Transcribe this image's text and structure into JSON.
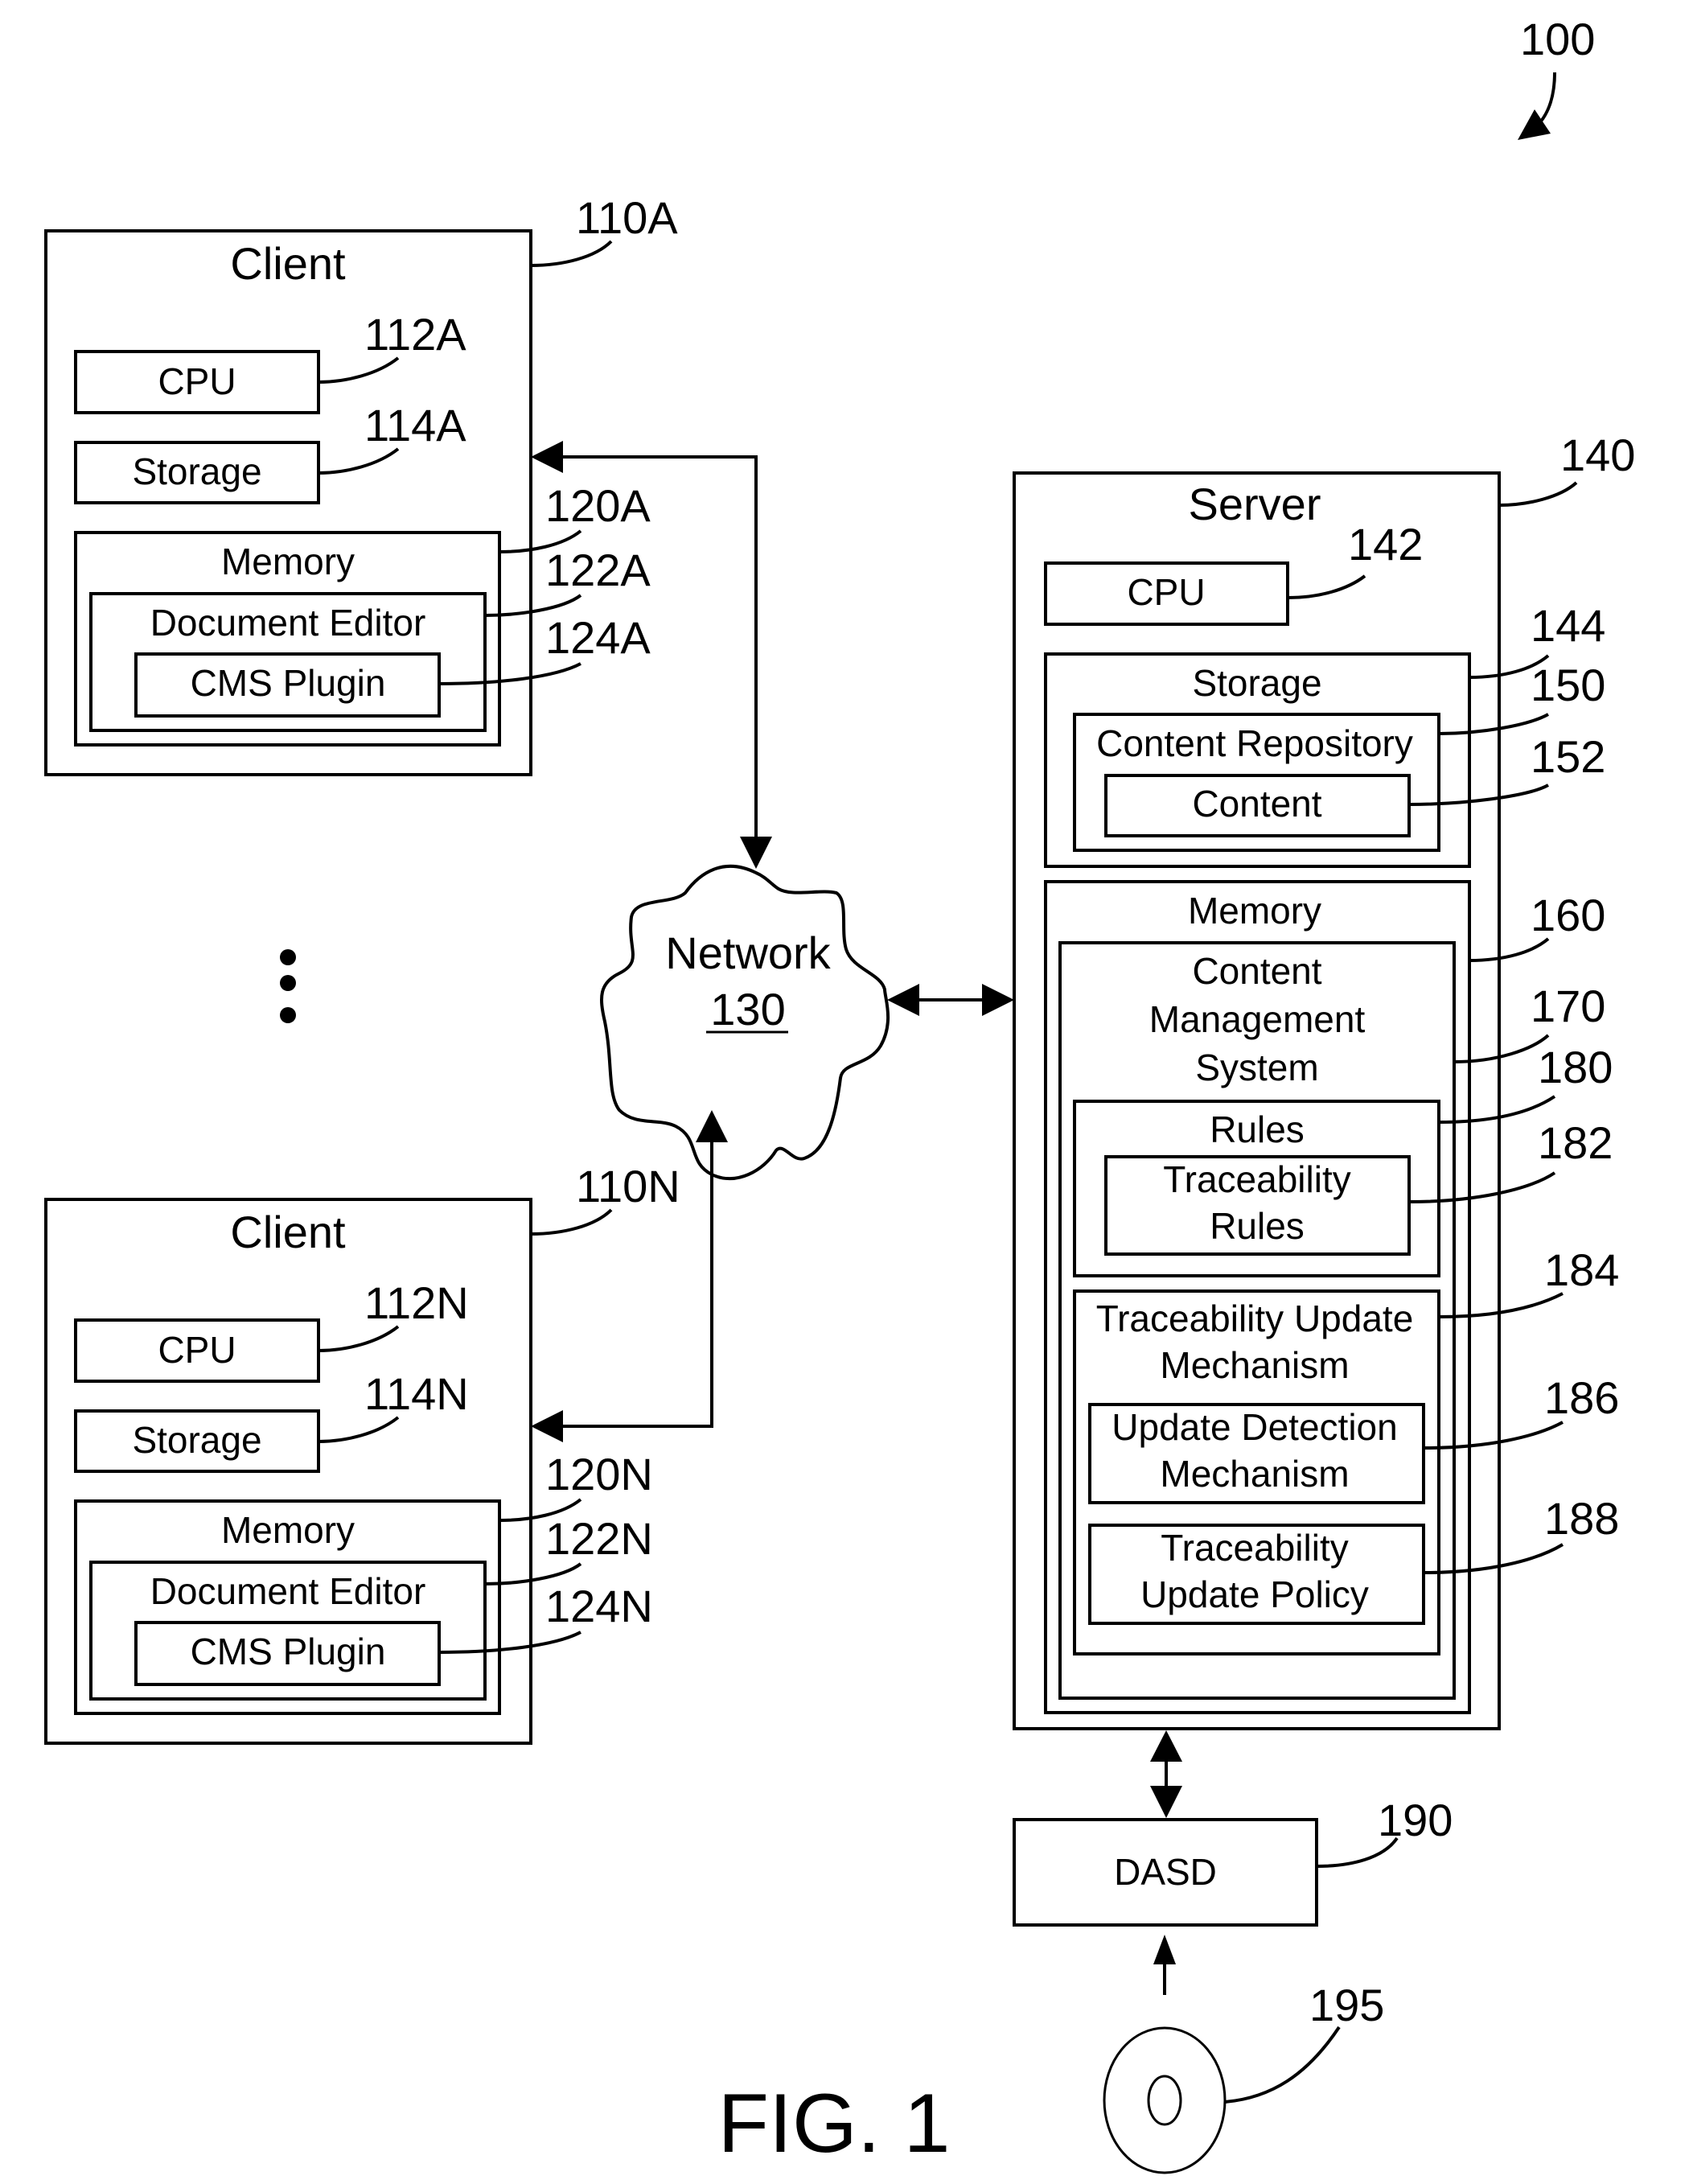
{
  "figure": {
    "caption": "FIG. 1",
    "system_ref": "100"
  },
  "client_a": {
    "title": "Client",
    "ref": "110A",
    "cpu": {
      "label": "CPU",
      "ref": "112A"
    },
    "storage": {
      "label": "Storage",
      "ref": "114A"
    },
    "memory": {
      "label": "Memory",
      "ref": "120A"
    },
    "document_editor": {
      "label": "Document Editor",
      "ref": "122A"
    },
    "cms_plugin": {
      "label": "CMS Plugin",
      "ref": "124A"
    }
  },
  "client_n": {
    "title": "Client",
    "ref": "110N",
    "cpu": {
      "label": "CPU",
      "ref": "112N"
    },
    "storage": {
      "label": "Storage",
      "ref": "114N"
    },
    "memory": {
      "label": "Memory",
      "ref": "120N"
    },
    "document_editor": {
      "label": "Document Editor",
      "ref": "122N"
    },
    "cms_plugin": {
      "label": "CMS Plugin",
      "ref": "124N"
    }
  },
  "network": {
    "label": "Network",
    "ref": "130"
  },
  "server": {
    "title": "Server",
    "ref": "140",
    "cpu": {
      "label": "CPU",
      "ref": "142"
    },
    "storage": {
      "label": "Storage",
      "ref": "144"
    },
    "content_repository": {
      "label": "Content Repository",
      "ref": "150"
    },
    "content": {
      "label": "Content",
      "ref": "152"
    },
    "memory": {
      "label": "Memory",
      "ref": "160"
    },
    "cms": {
      "line1": "Content",
      "line2": "Management",
      "line3": "System",
      "ref": "170"
    },
    "rules": {
      "label": "Rules",
      "ref": "180"
    },
    "traceability_rules": {
      "line1": "Traceability",
      "line2": "Rules",
      "ref": "182"
    },
    "traceability_update_mechanism": {
      "line1": "Traceability Update",
      "line2": "Mechanism",
      "ref": "184"
    },
    "update_detection_mechanism": {
      "line1": "Update Detection",
      "line2": "Mechanism",
      "ref": "186"
    },
    "traceability_update_policy": {
      "line1": "Traceability",
      "line2": "Update Policy",
      "ref": "188"
    }
  },
  "dasd": {
    "label": "DASD",
    "ref": "190"
  },
  "disc": {
    "ref": "195"
  }
}
